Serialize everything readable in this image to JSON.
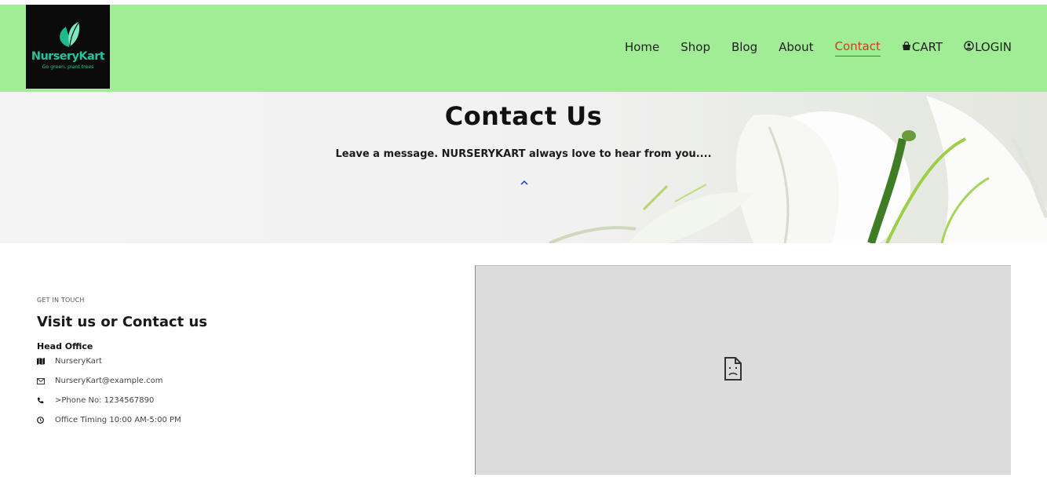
{
  "brand": {
    "name": "NurseryKart",
    "tagline": "Go green, plant trees"
  },
  "nav": {
    "items": [
      {
        "label": "Home",
        "active": false
      },
      {
        "label": "Shop",
        "active": false
      },
      {
        "label": "Blog",
        "active": false
      },
      {
        "label": "About",
        "active": false
      },
      {
        "label": "Contact",
        "active": true
      }
    ],
    "cart_label": "CART",
    "login_label": "LOGIN"
  },
  "hero": {
    "title": "Contact Us",
    "subtitle": "Leave a message. NURSERYKART always love to hear from you...."
  },
  "contact": {
    "eyebrow": "GET IN TOUCH",
    "heading": "Visit us or Contact us",
    "subheading": "Head Office",
    "items": [
      {
        "icon": "map-icon",
        "text": "NurseryKart"
      },
      {
        "icon": "envelope-icon",
        "text": "NurseryKart@example.com"
      },
      {
        "icon": "phone-icon",
        "text": ">Phone No: 1234567890"
      },
      {
        "icon": "clock-icon",
        "text": "Office Timing 10:00 AM-5:00 PM"
      }
    ]
  },
  "colors": {
    "header_bg": "#a1ed96",
    "active_nav": "#d6391e",
    "brand_teal": "#22c39a",
    "map_bg": "#dcdcdc"
  }
}
